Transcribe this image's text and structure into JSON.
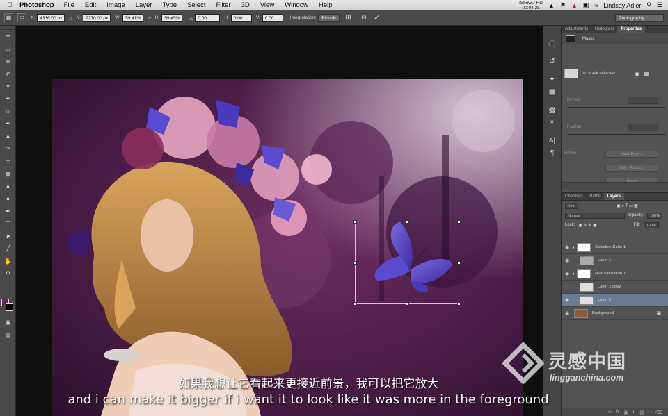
{
  "menubar": {
    "app_name": "Photoshop",
    "menus": [
      "File",
      "Edit",
      "Image",
      "Layer",
      "Type",
      "Select",
      "Filter",
      "3D",
      "View",
      "Window",
      "Help"
    ],
    "status_top": "iShowU HD",
    "status_time": "00:04:25",
    "user": "Lindsay Adler"
  },
  "options": {
    "x_label": "X:",
    "x_value": "4336.00 px",
    "y_label": "Y:",
    "y_value": "2270.00 px",
    "w_label": "W:",
    "w_value": "59.41%",
    "h_label": "H:",
    "h_value": "59.45%",
    "angle_value": "0.00",
    "h2_label": "H:",
    "h2_value": "0.00",
    "v_label": "V:",
    "v_value": "0.00",
    "interp_label": "Interpolation:",
    "interp_value": "Bicubic",
    "workspace": "Photography"
  },
  "panel": {
    "top_tabs": [
      "Adjustments",
      "Histogram",
      "Properties"
    ],
    "masks_title": "Masks",
    "no_mask": "No mask selected",
    "density": "Density:",
    "feather": "Feather:",
    "refine": "Refine:",
    "mask_edge": "Mask Edge...",
    "color_range": "Color Range...",
    "invert": "Invert"
  },
  "layers_panel": {
    "tabs": [
      "Channels",
      "Paths",
      "Layers"
    ],
    "kind": "Kind",
    "blend": "Normal",
    "opacity_label": "Opacity:",
    "opacity": "100%",
    "lock_label": "Lock:",
    "fill_label": "Fill:",
    "fill": "100%",
    "layers": [
      {
        "name": "Selective Color 1"
      },
      {
        "name": "Layer 1"
      },
      {
        "name": "Hue/Saturation 1"
      },
      {
        "name": "Layer 2 copy"
      },
      {
        "name": "Layer 2"
      },
      {
        "name": "Background"
      }
    ]
  },
  "subtitles": {
    "cn": "如果我想让它看起来更接近前景，我可以把它放大",
    "en": "and i can make it bigger if i want it to look like it was more in the foreground"
  },
  "watermark": {
    "cn": "灵感中国",
    "en": "lingganchina.com"
  },
  "colors": {
    "foreground": "#6b1f5b",
    "background": "#000000",
    "selected_layer": "#6c7c93"
  }
}
